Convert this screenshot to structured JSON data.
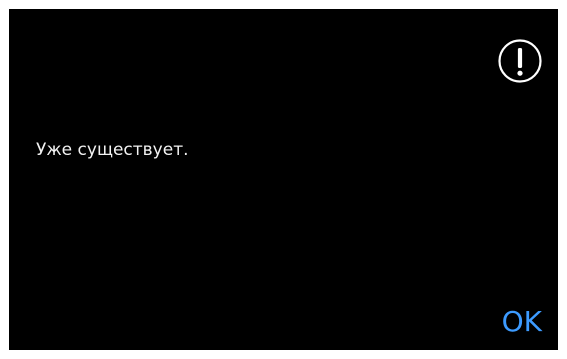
{
  "dialog": {
    "icon": "exclamation-circle-icon",
    "message": "Уже существует.",
    "ok_label": "OK"
  },
  "colors": {
    "background": "#000000",
    "text": "#f2f2f2",
    "accent": "#3d9bff",
    "outer_border": "#ffffff"
  }
}
